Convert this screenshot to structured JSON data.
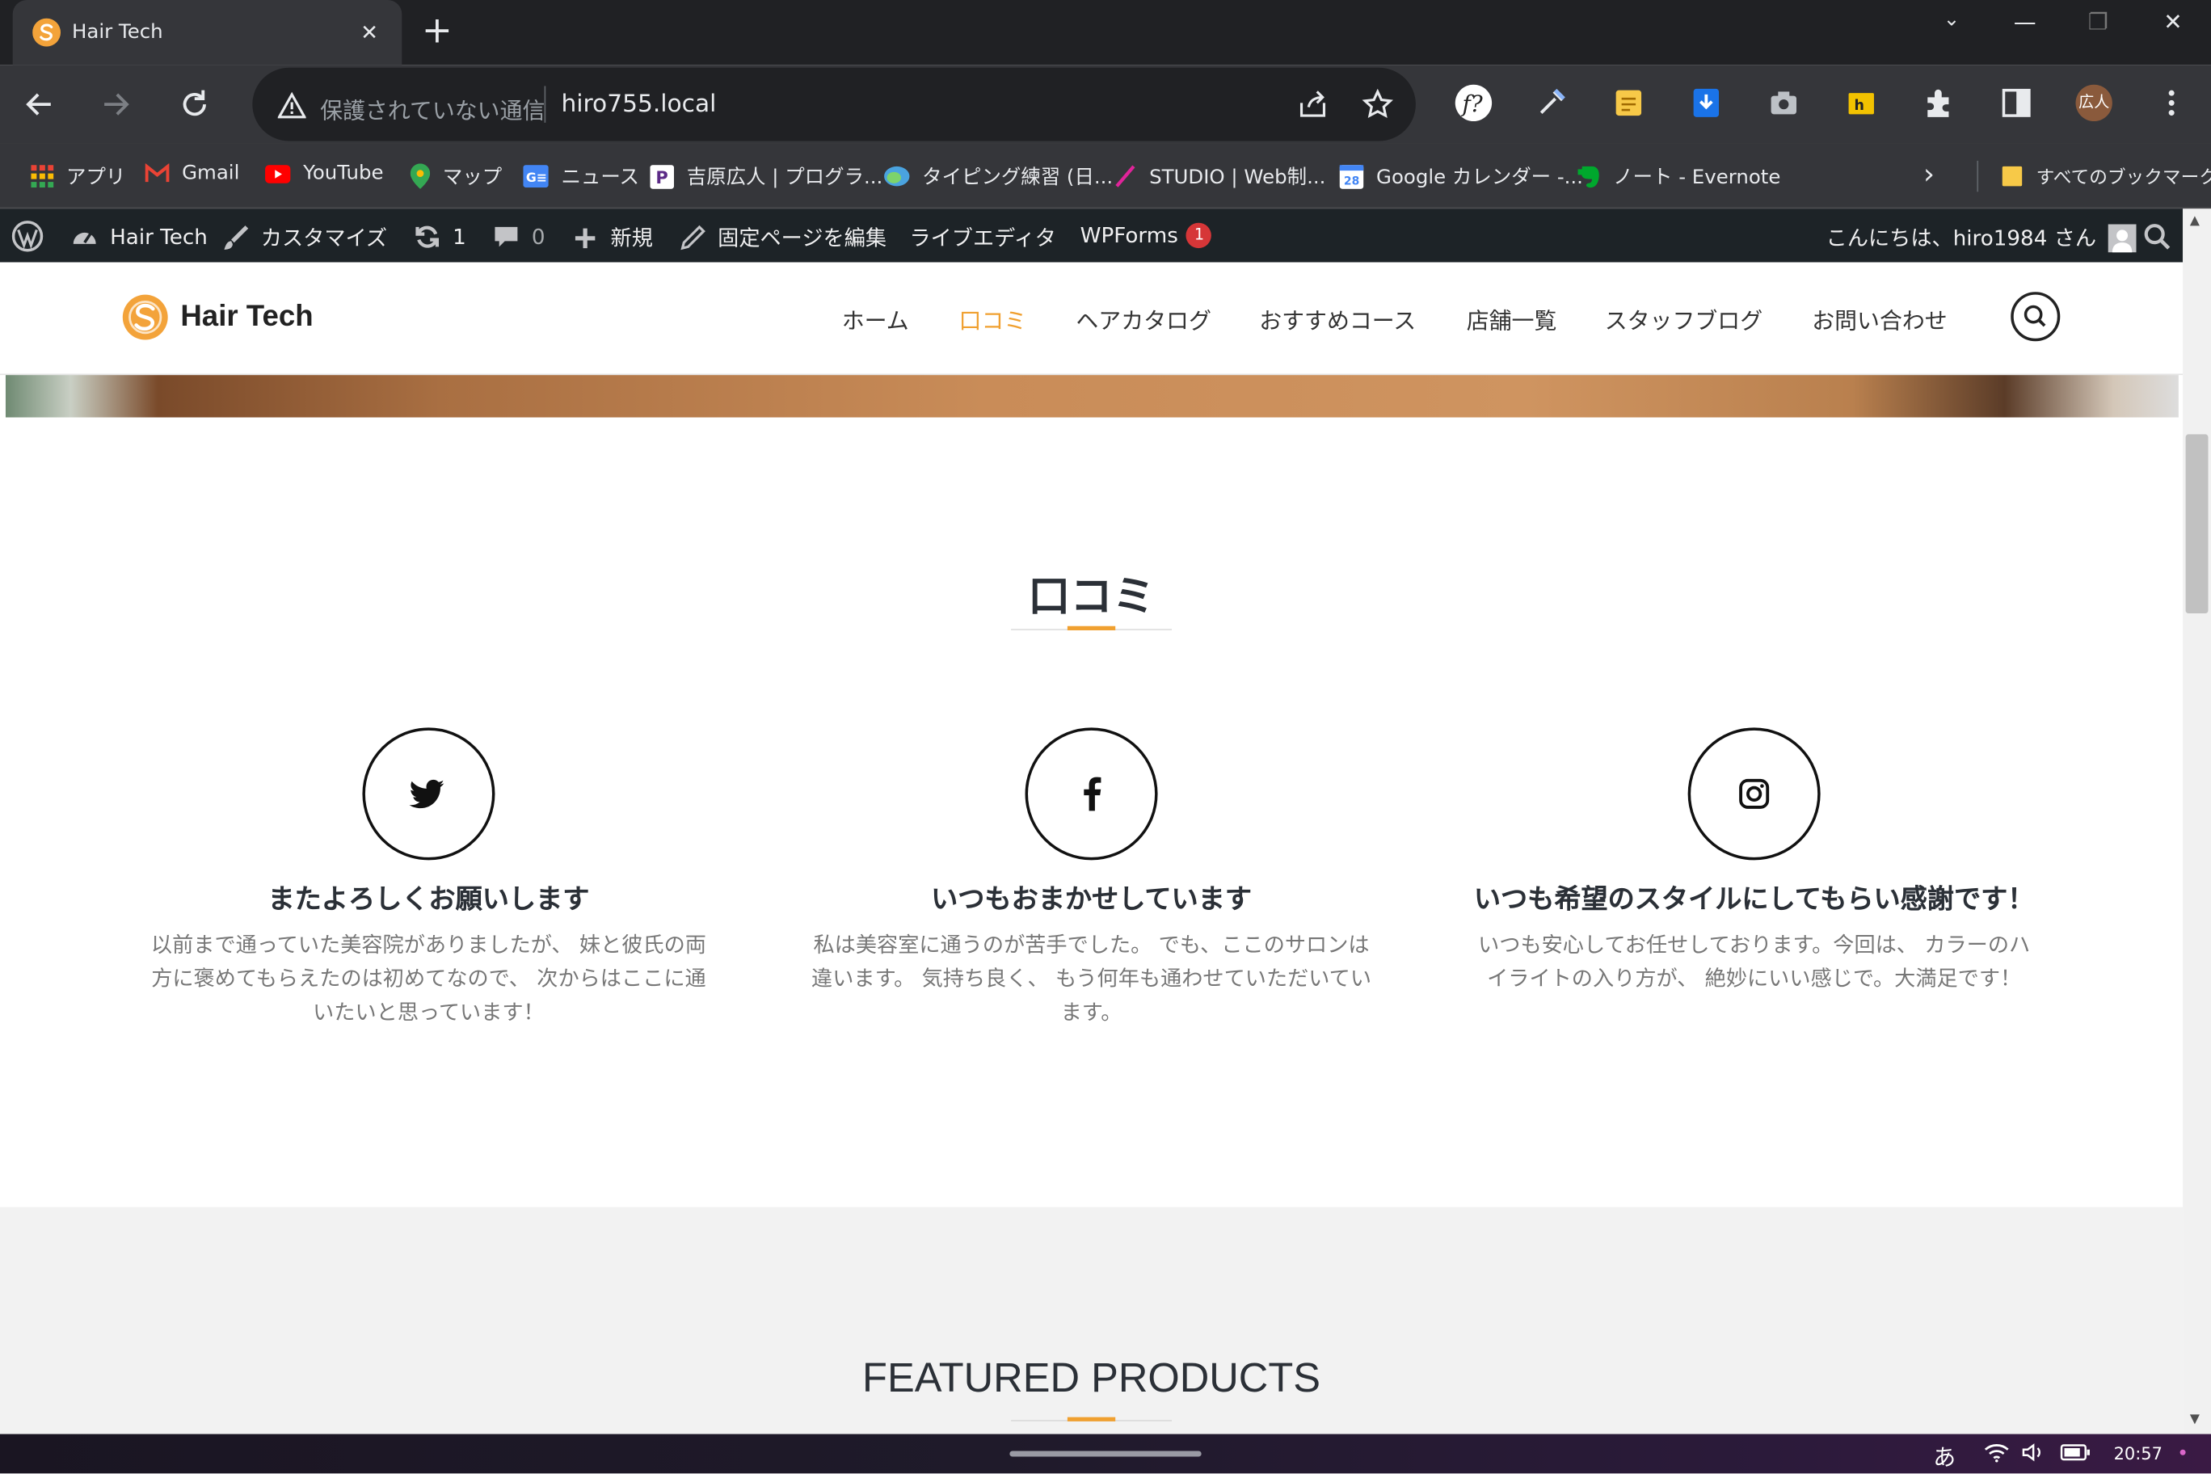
{
  "browser": {
    "tab": {
      "title": "Hair Tech",
      "close": "✕"
    },
    "newtab": "+",
    "window_controls": [
      "⌄",
      "—",
      "❐",
      "✕"
    ],
    "omnibox": {
      "security_label": "保護されていない通信",
      "url": "hiro755.local"
    },
    "profile_label": "広人",
    "bookmarks": [
      {
        "label": "アプリ",
        "color": "#e8453c"
      },
      {
        "label": "Gmail",
        "color": "#ea4335"
      },
      {
        "label": "YouTube",
        "color": "#ff0000"
      },
      {
        "label": "マップ",
        "color": "#34a853"
      },
      {
        "label": "ニュース",
        "color": "#4285f4"
      },
      {
        "label": "吉原広人 | プログラ...",
        "color": "#5b2a86"
      },
      {
        "label": "タイピング練習 (日...",
        "color": "#4aa3df"
      },
      {
        "label": "STUDIO | Web制...",
        "color": "#e0249a"
      },
      {
        "label": "Google カレンダー -...",
        "color": "#4285f4"
      },
      {
        "label": "ノート - Evernote",
        "color": "#00a82d"
      }
    ],
    "bookmarks_more": "›",
    "all_bookmarks": "すべてのブックマーク"
  },
  "adminbar": {
    "site": "Hair Tech",
    "customize": "カスタマイズ",
    "updates": "1",
    "comments": "0",
    "new": "新規",
    "edit_page": "固定ページを編集",
    "live_editor": "ライブエディタ",
    "wpforms": "WPForms",
    "wpforms_badge": "1",
    "greeting": "こんにちは、hiro1984 さん"
  },
  "site": {
    "logo": "Hair Tech",
    "nav": [
      "ホーム",
      "口コミ",
      "ヘアカタログ",
      "おすすめコース",
      "店舗一覧",
      "スタッフブログ",
      "お問い合わせ"
    ],
    "accent": "#f0a030"
  },
  "reviews": {
    "title": "口コミ",
    "cards": [
      {
        "icon": "twitter",
        "title": "またよろしくお願いします",
        "lines": [
          "以前まで通っていた美容院がありましたが、 妹と彼氏の両",
          "方に褒めてもらえたのは初めてなので、 次からはここに通",
          "いたいと思っています！"
        ]
      },
      {
        "icon": "facebook",
        "title": "いつもおまかせしています",
        "lines": [
          "私は美容室に通うのが苦手でした。 でも、ここのサロンは",
          "違います。 気持ち良く、 もう何年も通わせていただいてい",
          "ます。"
        ]
      },
      {
        "icon": "instagram",
        "title": "いつも希望のスタイルにしてもらい感謝です！",
        "lines": [
          "いつも安心してお任せしております。今回は、 カラーのハ",
          "イライトの入り方が、 絶妙にいい感じで。大満足です！"
        ]
      }
    ]
  },
  "featured": {
    "title": "FEATURED PRODUCTS"
  },
  "taskbar": {
    "ime": "あ",
    "time": "20:57"
  }
}
